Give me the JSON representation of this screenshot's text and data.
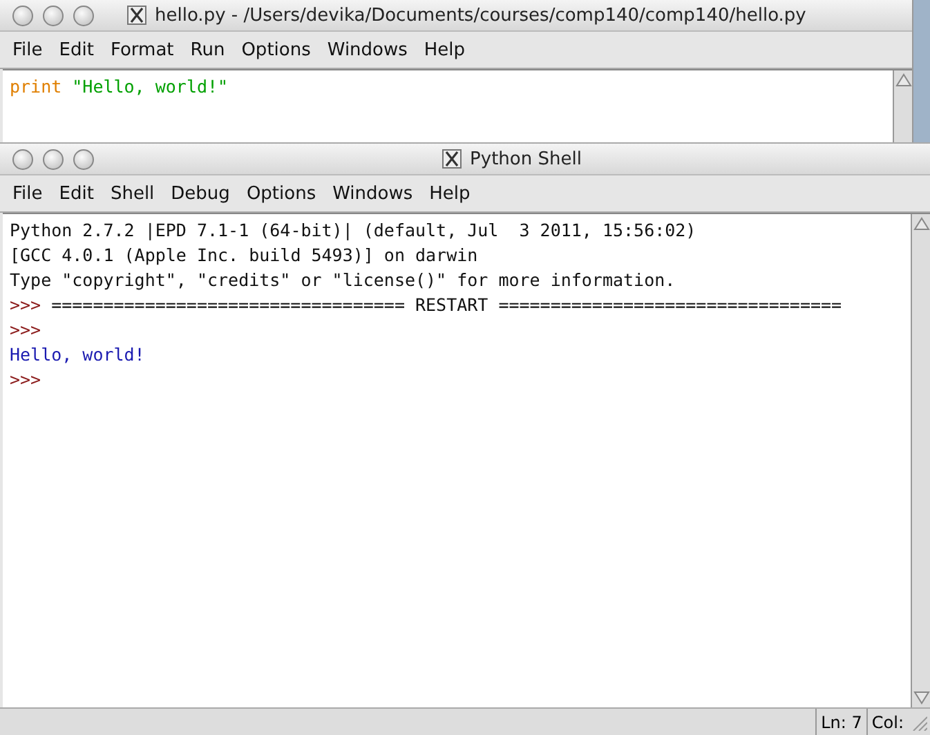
{
  "editor_window": {
    "title": "hello.py - /Users/devika/Documents/courses/comp140/comp140/hello.py",
    "menu": [
      "File",
      "Edit",
      "Format",
      "Run",
      "Options",
      "Windows",
      "Help"
    ],
    "lines": [
      [
        {
          "kind": "keyword",
          "text": "print"
        },
        {
          "kind": "string",
          "text": "\"Hello, world!\""
        }
      ]
    ]
  },
  "shell_window": {
    "title": "Python Shell",
    "menu": [
      "File",
      "Edit",
      "Shell",
      "Debug",
      "Options",
      "Windows",
      "Help"
    ],
    "lines": [
      [
        {
          "kind": "output",
          "text": "Python 2.7.2 |EPD 7.1-1 (64-bit)| (default, Jul  3 2011, 15:56:02)"
        }
      ],
      [
        {
          "kind": "output",
          "text": "[GCC 4.0.1 (Apple Inc. build 5493)] on darwin"
        }
      ],
      [
        {
          "kind": "output",
          "text": "Type \"copyright\", \"credits\" or \"license()\" for more information."
        }
      ],
      [
        {
          "kind": "prompt",
          "text": ">>>"
        },
        {
          "kind": "output",
          "text": "================================== RESTART ================================="
        }
      ],
      [
        {
          "kind": "prompt",
          "text": ">>>"
        }
      ],
      [
        {
          "kind": "stdout",
          "text": "Hello, world!"
        }
      ],
      [
        {
          "kind": "prompt",
          "text": ">>>"
        }
      ]
    ],
    "status": [
      "Ln: 7",
      "Col:"
    ]
  }
}
